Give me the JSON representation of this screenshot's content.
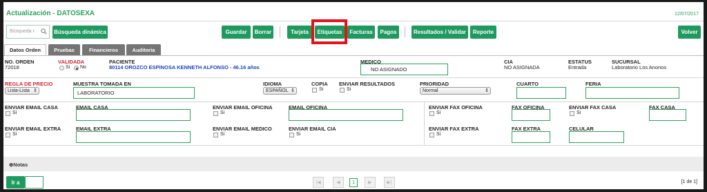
{
  "app": {
    "title": "Actualización - DATOSEXA",
    "date": "12/07/2017"
  },
  "toolbar": {
    "search_placeholder": "Búsqueda r",
    "dynamic_search": "Búsqueda dinámica",
    "save": "Guardar",
    "delete": "Borrar",
    "card": "Tarjeta",
    "labels": "Etiquetas",
    "invoices": "Facturas",
    "payments": "Pagos",
    "results": "Resultados / Validar",
    "report": "Reporte",
    "back": "Volver"
  },
  "tabs": [
    "Datos Orden",
    "Pruebas",
    "Financieros",
    "Auditoria"
  ],
  "order": {
    "no_orden_label": "NO. ORDEN",
    "no_orden": "72018",
    "validada_label": "VALIDADA",
    "validada_si": "Si",
    "validada_no": "No",
    "paciente_label": "PACIENTE",
    "paciente": "80114 OROZCO ESPINOSA KENNETH ALFONSO - 46.16 años",
    "medico_label": "MEDICO",
    "medico": "NO ASIGNADO",
    "cia_label": "CIA",
    "cia": "NO ASIGNADA",
    "estatus_label": "ESTATUS",
    "estatus": "Entrada",
    "sucursal_label": "SUCURSAL",
    "sucursal": "Laboratorio Los Anonos"
  },
  "row2": {
    "regla_label": "REGLA DE PRECIO",
    "regla": "Lista-Lista",
    "muestra_label": "MUESTRA TOMADA EN",
    "muestra": "LABORATORIO",
    "idioma_label": "IDIOMA",
    "idioma": "ESPAÑOL",
    "copia_label": "COPIA",
    "copia_si": "Si",
    "enviar_res_label": "ENVIAR RESULTADOS",
    "enviar_res_si": "Si",
    "prioridad_label": "PRIORIDAD",
    "prioridad": "Normal",
    "cuarto_label": "CUARTO",
    "feria_label": "FERIA"
  },
  "contacts": {
    "env_email_casa": "ENVIAR EMAIL CASA",
    "email_casa": "EMAIL CASA",
    "env_email_oficina": "ENVIAR EMAIL OFICINA",
    "email_oficina": "EMAIL OFICINA",
    "env_email_extra": "ENVIAR EMAIL EXTRA",
    "email_extra": "EMAIL EXTRA",
    "env_email_medico": "ENVIAR EMAIL MEDICO",
    "env_email_cia": "ENVIAR EMAIL CIA",
    "env_fax_oficina": "ENVIAR FAX OFICINA",
    "fax_oficina": "FAX OFICINA",
    "env_fax_casa": "ENVIAR FAX CASA",
    "fax_casa": "FAX CASA",
    "env_fax_extra": "ENVIAR FAX EXTRA",
    "fax_extra": "FAX EXTRA",
    "celular": "CELULAR",
    "si": "Si"
  },
  "notes": {
    "label": "Notas"
  },
  "footer": {
    "goto": "Ir a",
    "page": "1",
    "page_info": "[1 de 1]"
  },
  "colors": {
    "green": "#1f9a5e",
    "title_green": "#2aa35a",
    "highlight": "#e5121a",
    "required": "#d6232f",
    "patient": "#1a43c2"
  }
}
